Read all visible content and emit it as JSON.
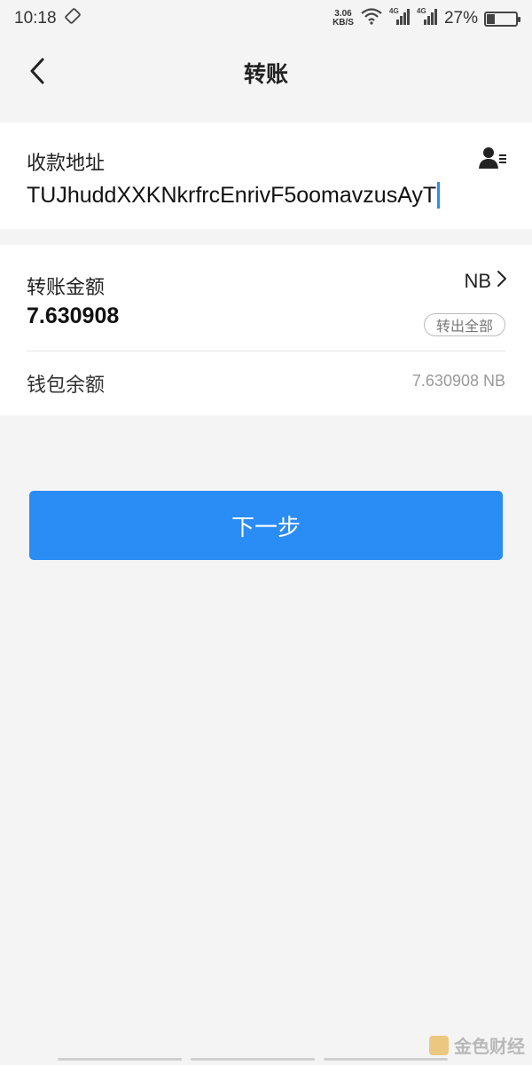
{
  "status_bar": {
    "time": "10:18",
    "net_speed_value": "3.06",
    "net_speed_unit": "KB/S",
    "sim1": "4G",
    "sim2": "4G",
    "battery_percent": "27%",
    "battery_level": 0.27
  },
  "nav": {
    "title": "转账",
    "back_icon": "chevron-left-icon"
  },
  "address_section": {
    "label": "收款地址",
    "value": "TUJhuddXXKNkrfrcEnrivF5oomavzusAyT",
    "contacts_icon": "address-book-icon"
  },
  "amount_section": {
    "label": "转账金额",
    "currency": "NB",
    "amount": "7.630908",
    "max_button": "转出全部",
    "balance_label": "钱包余额",
    "balance_value": "7.630908 NB"
  },
  "actions": {
    "next_button": "下一步"
  },
  "watermark": {
    "text": "金色财经"
  },
  "colors": {
    "accent": "#2a8cf5",
    "background": "#f4f4f4",
    "card": "#ffffff"
  }
}
